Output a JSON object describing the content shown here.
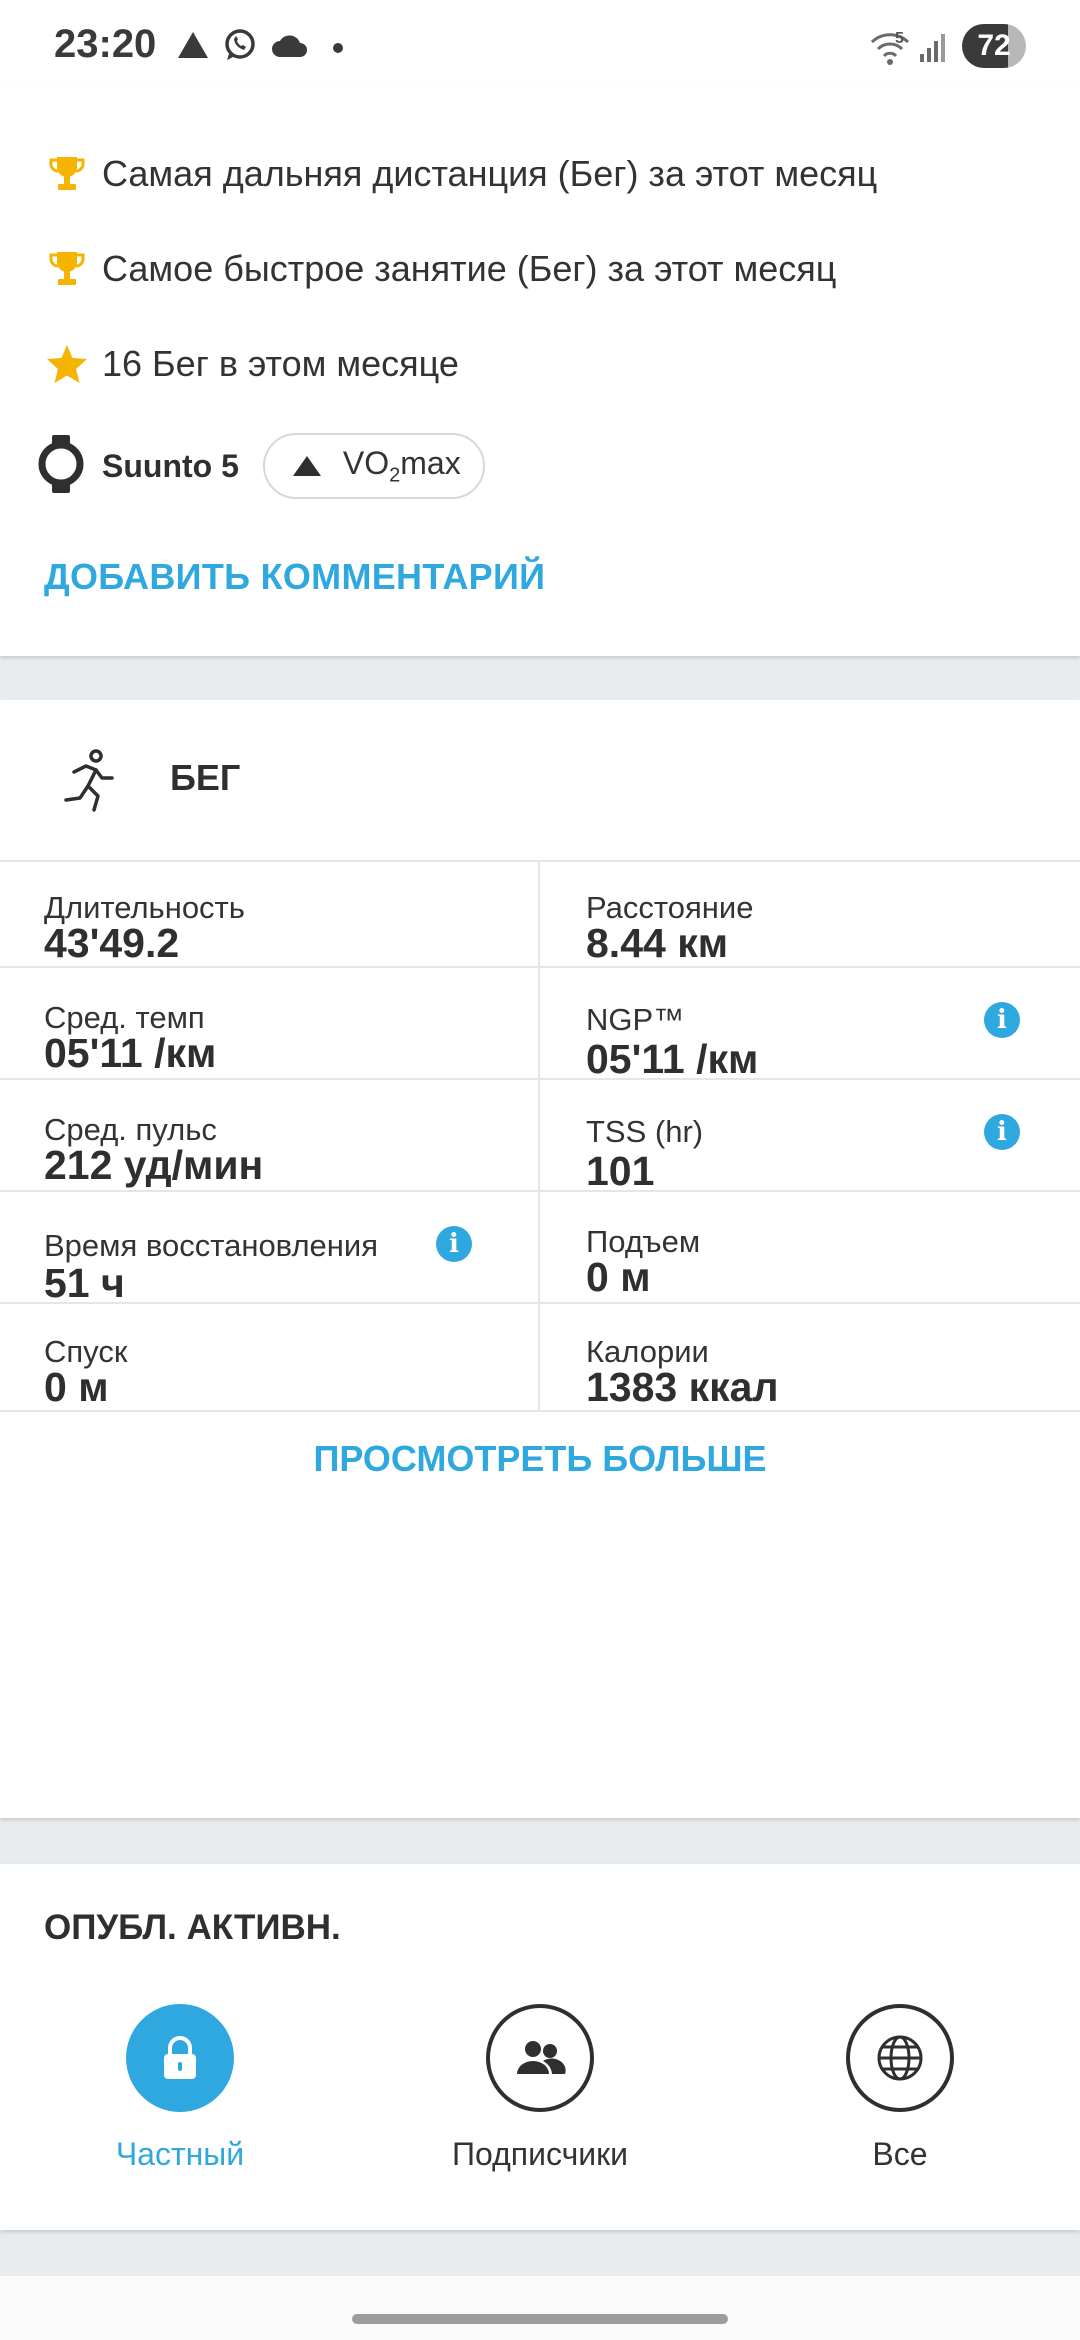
{
  "status_bar": {
    "time": "23:20",
    "icons": [
      "warning-triangle-icon",
      "whatsapp-icon",
      "cloud-icon",
      "dot-icon",
      "wifi-icon",
      "signal-icon"
    ],
    "wifi_badge": "5",
    "battery": "72"
  },
  "achievements": [
    {
      "icon": "trophy-icon",
      "text": "Самая дальняя дистанция (Бег) за этот месяц"
    },
    {
      "icon": "trophy-icon",
      "text": "Самое быстрое занятие (Бег) за этот месяц"
    },
    {
      "icon": "star-icon",
      "text": "16 Бег в этом месяце"
    }
  ],
  "device": {
    "name": "Suunto 5",
    "chip_prefix": "VO",
    "chip_sub": "2",
    "chip_suffix": "max"
  },
  "add_comment": "ДОБАВИТЬ КОММЕНТАРИЙ",
  "sport": {
    "icon": "running-icon",
    "name": "БЕГ"
  },
  "stats": [
    {
      "label": "Длительность",
      "value": "43'49.2",
      "info": false
    },
    {
      "label": "Расстояние",
      "value": "8.44 км",
      "info": false
    },
    {
      "label": "Сред. темп",
      "value": "05'11 /км",
      "info": false
    },
    {
      "label": "NGP™",
      "value": "05'11 /км",
      "info": true
    },
    {
      "label": "Сред. пульс",
      "value": "212 уд/мин",
      "info": false
    },
    {
      "label": "TSS (hr)",
      "value": "101",
      "info": true
    },
    {
      "label": "Время восстановления",
      "value": "51 ч",
      "info": true
    },
    {
      "label": "Подъем",
      "value": "0 м",
      "info": false
    },
    {
      "label": "Спуск",
      "value": "0 м",
      "info": false
    },
    {
      "label": "Калории",
      "value": "1383 ккал",
      "info": false
    }
  ],
  "view_more": "ПРОСМОТРЕТЬ БОЛЬШЕ",
  "share": {
    "title": "ОПУБЛ. АКТИВН.",
    "options": [
      {
        "label": "Частный",
        "icon": "lock-icon",
        "selected": true
      },
      {
        "label": "Подписчики",
        "icon": "people-icon",
        "selected": false
      },
      {
        "label": "Все",
        "icon": "globe-icon",
        "selected": false
      }
    ]
  },
  "colors": {
    "accent": "#2fa8e0",
    "text": "#303030",
    "divider": "#e6e6e6",
    "background": "#e9ecee"
  }
}
